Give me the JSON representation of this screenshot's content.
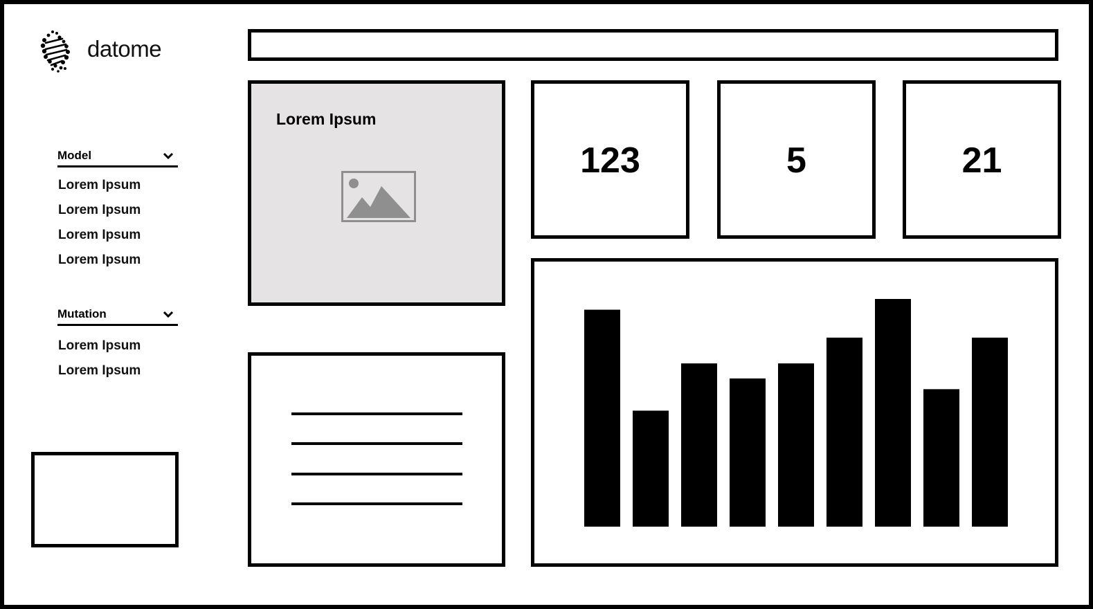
{
  "brand": {
    "name": "datome",
    "logo_icon": "dna-dots-icon"
  },
  "search": {
    "value": ""
  },
  "sidebar": {
    "sections": [
      {
        "title": "Model",
        "items": [
          "Lorem Ipsum",
          "Lorem Ipsum",
          "Lorem Ipsum",
          "Lorem Ipsum"
        ]
      },
      {
        "title": "Mutation",
        "items": [
          "Lorem Ipsum",
          "Lorem Ipsum"
        ]
      }
    ]
  },
  "image_card": {
    "title": "Lorem Ipsum",
    "icon": "image-placeholder-icon"
  },
  "stats": [
    "123",
    "5",
    "21"
  ],
  "chart_data": {
    "type": "bar",
    "values": [
      10.1,
      5.4,
      7.6,
      6.9,
      7.6,
      8.8,
      10.6,
      6.4,
      8.8
    ],
    "ylim": [
      0,
      10.6
    ],
    "title": "",
    "xlabel": "",
    "ylabel": ""
  },
  "colors": {
    "stroke": "#000000",
    "image_card_bg": "#e5e3e4",
    "placeholder_icon": "#8f8f8f"
  }
}
